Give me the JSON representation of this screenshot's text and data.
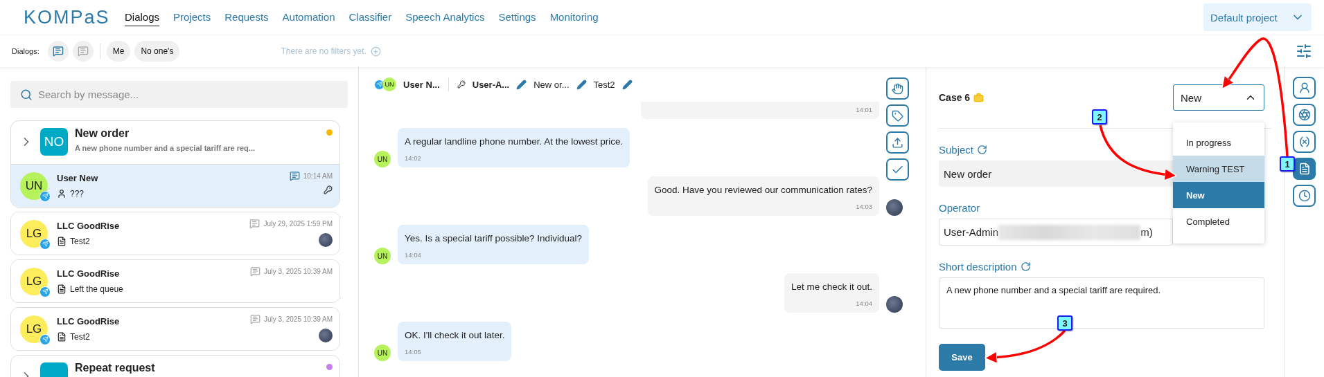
{
  "logo": "KOMPaS",
  "nav": [
    {
      "label": "Dialogs",
      "selected": true
    },
    {
      "label": "Projects",
      "selected": false
    },
    {
      "label": "Requests",
      "selected": false
    },
    {
      "label": "Automation",
      "selected": false
    },
    {
      "label": "Classifier",
      "selected": false
    },
    {
      "label": "Speech Analytics",
      "selected": false
    },
    {
      "label": "Settings",
      "selected": false
    },
    {
      "label": "Monitoring",
      "selected": false
    }
  ],
  "project_select": {
    "value": "Default project"
  },
  "filter_bar": {
    "label": "Dialogs:",
    "toggles": [
      {
        "selected": true
      },
      {
        "selected": false
      }
    ],
    "chips": [
      "Me",
      "No one's"
    ],
    "empty_text": "There are no filters yet."
  },
  "search": {
    "placeholder": "Search by message..."
  },
  "dialogs": [
    {
      "kind": "case",
      "initials": "NO",
      "title": "New order",
      "subtitle": "A new phone number and a special tariff are req...",
      "color": "#fbb800",
      "children": [
        {
          "kind": "chat",
          "avatar": {
            "initials": "UN",
            "color": "#b6f25c"
          },
          "name": "User New",
          "preview": {
            "kind": "person",
            "text": "???"
          },
          "time": "10:14 AM",
          "selected": true,
          "assignee": {
            "kind": "key"
          }
        }
      ]
    },
    {
      "kind": "chat",
      "avatar": {
        "initials": "LG",
        "color": "#fdec5c"
      },
      "name": "LLC GoodRise",
      "preview": {
        "kind": "document",
        "text": "Test2"
      },
      "time": "July 29, 2025 1:59 PM",
      "selected": false,
      "assignee": {
        "kind": "avatar"
      }
    },
    {
      "kind": "chat",
      "avatar": {
        "initials": "LG",
        "color": "#fdec5c"
      },
      "name": "LLC GoodRise",
      "preview": {
        "kind": "document",
        "text": "Left the queue"
      },
      "time": "July 3, 2025 10:39 AM",
      "selected": false
    },
    {
      "kind": "chat",
      "avatar": {
        "initials": "LG",
        "color": "#fdec5c"
      },
      "name": "LLC GoodRise",
      "preview": {
        "kind": "document",
        "text": "Test2"
      },
      "time": "July 3, 2025 10:39 AM",
      "selected": false,
      "assignee": {
        "kind": "avatar"
      }
    },
    {
      "kind": "case",
      "title": "Repeat request",
      "color": "#c77dec"
    }
  ],
  "chat_header": {
    "initials": "UN",
    "items": [
      {
        "kind": "user",
        "text": "User N...",
        "editable": false
      },
      {
        "kind": "operator",
        "text": "User-A...",
        "editable": true
      },
      {
        "kind": "plain",
        "text": "New or...",
        "editable": true
      },
      {
        "kind": "plain",
        "text": "Test2",
        "editable": true
      }
    ]
  },
  "messages": [
    {
      "kind": "outgoing",
      "time": "14:01"
    },
    {
      "kind": "incoming",
      "initials": "UN",
      "text": "A regular landline phone number. At the lowest price.",
      "time": "14:02"
    },
    {
      "kind": "outgoing",
      "text": "Good. Have you reviewed our communication rates?",
      "time": "14:03"
    },
    {
      "kind": "incoming",
      "initials": "UN",
      "text": "Yes. Is a special tariff possible? Individual?",
      "time": "14:04"
    },
    {
      "kind": "outgoing",
      "text": "Let me check it out.",
      "time": "14:04"
    },
    {
      "kind": "incoming",
      "initials": "UN",
      "text": "OK. I'll check it out later.",
      "time": "14:05"
    }
  ],
  "case_panel": {
    "title": "Case 6",
    "status": {
      "value": "New",
      "expanded": true,
      "options": [
        {
          "label": "In progress",
          "selected": false,
          "hovered": false
        },
        {
          "label": "Warning TEST",
          "selected": false,
          "hovered": true
        },
        {
          "label": "New",
          "selected": true,
          "hovered": false
        },
        {
          "label": "Completed",
          "selected": false,
          "hovered": false
        }
      ]
    },
    "subject": {
      "label": "Subject",
      "value": "New order"
    },
    "operator": {
      "label": "Operator",
      "value": "User-Admin",
      "redacted": true,
      "value_tail": "m)"
    },
    "description": {
      "label": "Short description",
      "value": "A new phone number and a special tariff are required."
    },
    "save": "Save"
  },
  "side_tools": [
    {
      "kind": "person",
      "selected": false
    },
    {
      "kind": "ai",
      "selected": false
    },
    {
      "kind": "variables",
      "selected": false
    },
    {
      "kind": "document",
      "selected": true
    },
    {
      "kind": "clock",
      "selected": false
    }
  ],
  "annotations": [
    {
      "label": "1"
    },
    {
      "label": "2"
    },
    {
      "label": "3"
    }
  ]
}
